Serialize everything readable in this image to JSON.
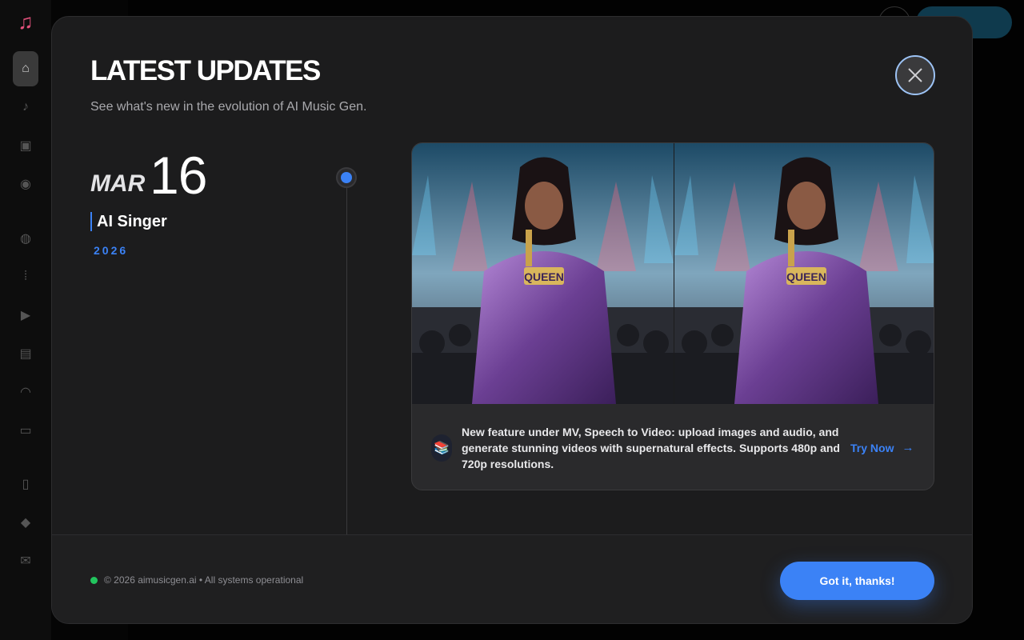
{
  "modal": {
    "title": "LATEST UPDATES",
    "subtitle": "See what's new in the evolution of AI Music Gen."
  },
  "entry": {
    "month": "MAR",
    "day": "16",
    "title": "AI Singer",
    "year": "2026",
    "badge_text": "QUEEN",
    "description": "New feature under MV, Speech to Video: upload images and audio, and generate stunning videos with supernatural effects. Supports 480p and 720p resolutions.",
    "cta_label": "Try Now",
    "cta_arrow": "→",
    "feature_icon": "books-icon"
  },
  "footer": {
    "status_text": "© 2026 aimusicgen.ai • All systems operational",
    "status_color": "#22c55e",
    "confirm_label": "Got it, thanks!"
  },
  "colors": {
    "accent": "#3b82f6",
    "modal_bg": "#1c1c1d"
  }
}
